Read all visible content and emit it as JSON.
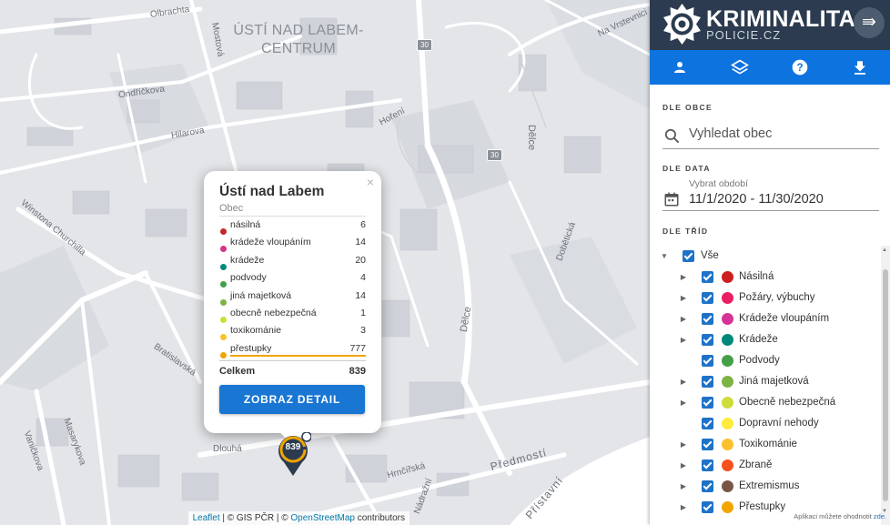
{
  "map": {
    "district_label_line1": "ÚSTÍ NAD LABEM-",
    "district_label_line2": "CENTRUM",
    "streets": [
      "Olbrachta",
      "Mostová",
      "Ondříčkova",
      "Hilarova",
      "Hoření",
      "Dělce",
      "Dělce",
      "Winstona Churchilla",
      "Bratislavská",
      "Masarykova",
      "Vaničkova",
      "Dlouhá",
      "Hrnčířská",
      "Předmostí",
      "Přístavní",
      "Nádražní",
      "Dobětická",
      "Na Vrstevnici"
    ],
    "shields": [
      "30",
      "30"
    ]
  },
  "popup": {
    "close": "×",
    "title": "Ústí nad Labem",
    "subtitle": "Obec",
    "rows": [
      {
        "label": "násilná",
        "value": "6",
        "color": "#c62828"
      },
      {
        "label": "krádeže vloupáním",
        "value": "14",
        "color": "#d63384"
      },
      {
        "label": "krádeže",
        "value": "20",
        "color": "#00897b"
      },
      {
        "label": "podvody",
        "value": "4",
        "color": "#43a047"
      },
      {
        "label": "jiná majetková",
        "value": "14",
        "color": "#7cb342"
      },
      {
        "label": "obecně nebezpečná",
        "value": "1",
        "color": "#cddc39"
      },
      {
        "label": "toxikománie",
        "value": "3",
        "color": "#fbc02d"
      },
      {
        "label": "přestupky",
        "value": "777",
        "color": "#f0a500"
      }
    ],
    "total_label": "Celkem",
    "total_value": "839",
    "detail_button": "ZOBRAZ DETAIL"
  },
  "marker": {
    "count": "839"
  },
  "attribution": {
    "leaflet": "Leaflet",
    "sep1": " | © GIS PČR | © ",
    "osm": "OpenStreetMap",
    "contrib": " contributors"
  },
  "sidebar": {
    "brand_name": "KRIMINALITA",
    "brand_site": "POLICIE.CZ",
    "toolbar_icons": [
      "person-icon",
      "layers-icon",
      "help-icon",
      "download-icon"
    ],
    "section_municipality": "DLE OBCE",
    "search_placeholder": "Vyhledat obec",
    "section_date": "DLE DATA",
    "date_label": "Vybrat období",
    "date_value": "11/1/2020 - 11/30/2020",
    "section_classes": "DLE TŘÍD",
    "tree_root": "Vše",
    "tree_items": [
      {
        "label": "Násilná",
        "color": "#cc1f1f",
        "expandable": true
      },
      {
        "label": "Požáry, výbuchy",
        "color": "#e91e63",
        "expandable": true
      },
      {
        "label": "Krádeže vloupáním",
        "color": "#d63398",
        "expandable": true
      },
      {
        "label": "Krádeže",
        "color": "#00897b",
        "expandable": true
      },
      {
        "label": "Podvody",
        "color": "#43a047",
        "expandable": false
      },
      {
        "label": "Jiná majetková",
        "color": "#7cb342",
        "expandable": true
      },
      {
        "label": "Obecně nebezpečná",
        "color": "#cddc39",
        "expandable": true
      },
      {
        "label": "Dopravní nehody",
        "color": "#ffeb3b",
        "expandable": false
      },
      {
        "label": "Toxikománie",
        "color": "#fbc02d",
        "expandable": true
      },
      {
        "label": "Zbraně",
        "color": "#f4511e",
        "expandable": true
      },
      {
        "label": "Extremismus",
        "color": "#795548",
        "expandable": true
      },
      {
        "label": "Přestupky",
        "color": "#f0a500",
        "expandable": true
      }
    ],
    "footer_text": "Aplikaci můžete ohodnotit ",
    "footer_link": "zde."
  }
}
